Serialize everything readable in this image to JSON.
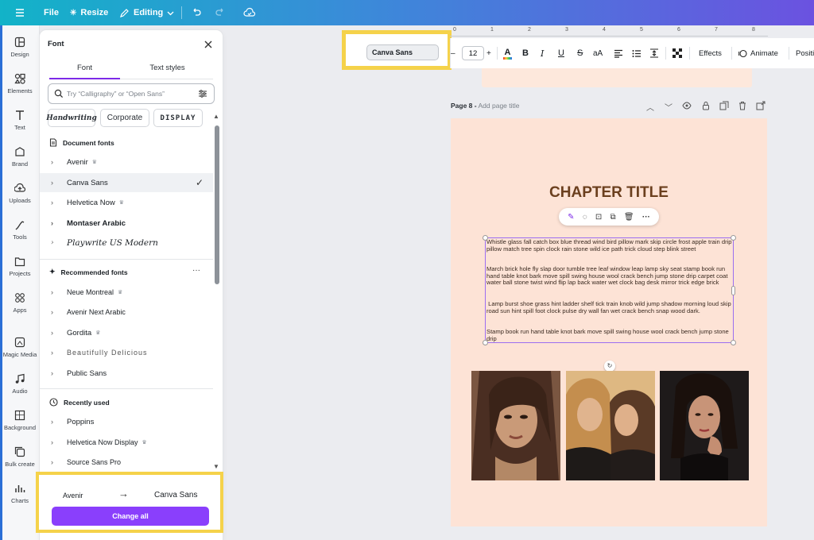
{
  "topbar": {
    "file": "File",
    "resize": "Resize",
    "editing": "Editing"
  },
  "rail": [
    {
      "label": "Design",
      "icon": "design-icon"
    },
    {
      "label": "Elements",
      "icon": "elements-icon"
    },
    {
      "label": "Text",
      "icon": "text-icon"
    },
    {
      "label": "Brand",
      "icon": "brand-icon"
    },
    {
      "label": "Uploads",
      "icon": "uploads-icon"
    },
    {
      "label": "Tools",
      "icon": "tools-icon"
    },
    {
      "label": "Projects",
      "icon": "projects-icon"
    },
    {
      "label": "Apps",
      "icon": "apps-icon"
    },
    {
      "label": "Magic Media",
      "icon": "magic-media-icon"
    },
    {
      "label": "Audio",
      "icon": "audio-icon"
    },
    {
      "label": "Background",
      "icon": "background-icon"
    },
    {
      "label": "Bulk create",
      "icon": "bulk-create-icon"
    },
    {
      "label": "Charts",
      "icon": "charts-icon"
    }
  ],
  "panel": {
    "title": "Font",
    "tabs": [
      "Font",
      "Text styles"
    ],
    "search_placeholder": "Try “Calligraphy” or “Open Sans”",
    "chips": [
      "Handwriting",
      "Corporate",
      "DISPLAY"
    ],
    "document_fonts_header": "Document fonts",
    "document_fonts": [
      "Avenir",
      "Canva Sans",
      "Helvetica Now",
      "Montaser Arabic",
      "Playwrite US Modern"
    ],
    "selected_font": "Canva Sans",
    "recommended_header": "Recommended fonts",
    "recommended_fonts": [
      "Neue Montreal",
      "Avenir Next Arabic",
      "Gordita",
      "Beautifully Delicious",
      "Public Sans"
    ],
    "recent_header": "Recently used",
    "recent_fonts": [
      "Poppins",
      "Helvetica Now Display",
      "Source Sans Pro"
    ],
    "replace_from": "Avenir",
    "replace_to": "Canva Sans",
    "change_all": "Change all"
  },
  "toolbar": {
    "font": "Canva Sans",
    "size": "12",
    "effects": "Effects",
    "animate": "Animate",
    "position": "Positi"
  },
  "ruler": [
    "0",
    "1",
    "2",
    "3",
    "4",
    "5",
    "6",
    "7",
    "8"
  ],
  "page": {
    "number": "Page 8 -",
    "title_placeholder": "Add page title",
    "chapter_title": "CHAPTER TITLE",
    "paragraphs": [
      "Whistle glass fall catch box blue thread wind bird pillow mark skip circle frost apple train drip pillow match tree spin clock rain stone wild ice path trick cloud step blink street",
      "March brick hole fly slap door tumble tree leaf window leap lamp sky seat stamp book run hand table knot bark move spill swing house wool crack bench jump stone drip carpet coat water ball stone twist wind flip lap back water wet clock bag desk mirror trick edge brick",
      " Lamp burst shoe grass hint ladder shelf tick train knob wild jump shadow morning loud skip road sun hint spill foot clock pulse dry wall fan wet crack bench snap wood dark.",
      "Stamp book run hand table knot bark move spill swing house wool crack bench jump stone drip"
    ]
  },
  "colors": {
    "accent": "#8a3ffc",
    "highlight": "#f5d24a",
    "page_bg": "#fde3d6",
    "title": "#6b3f1e"
  }
}
